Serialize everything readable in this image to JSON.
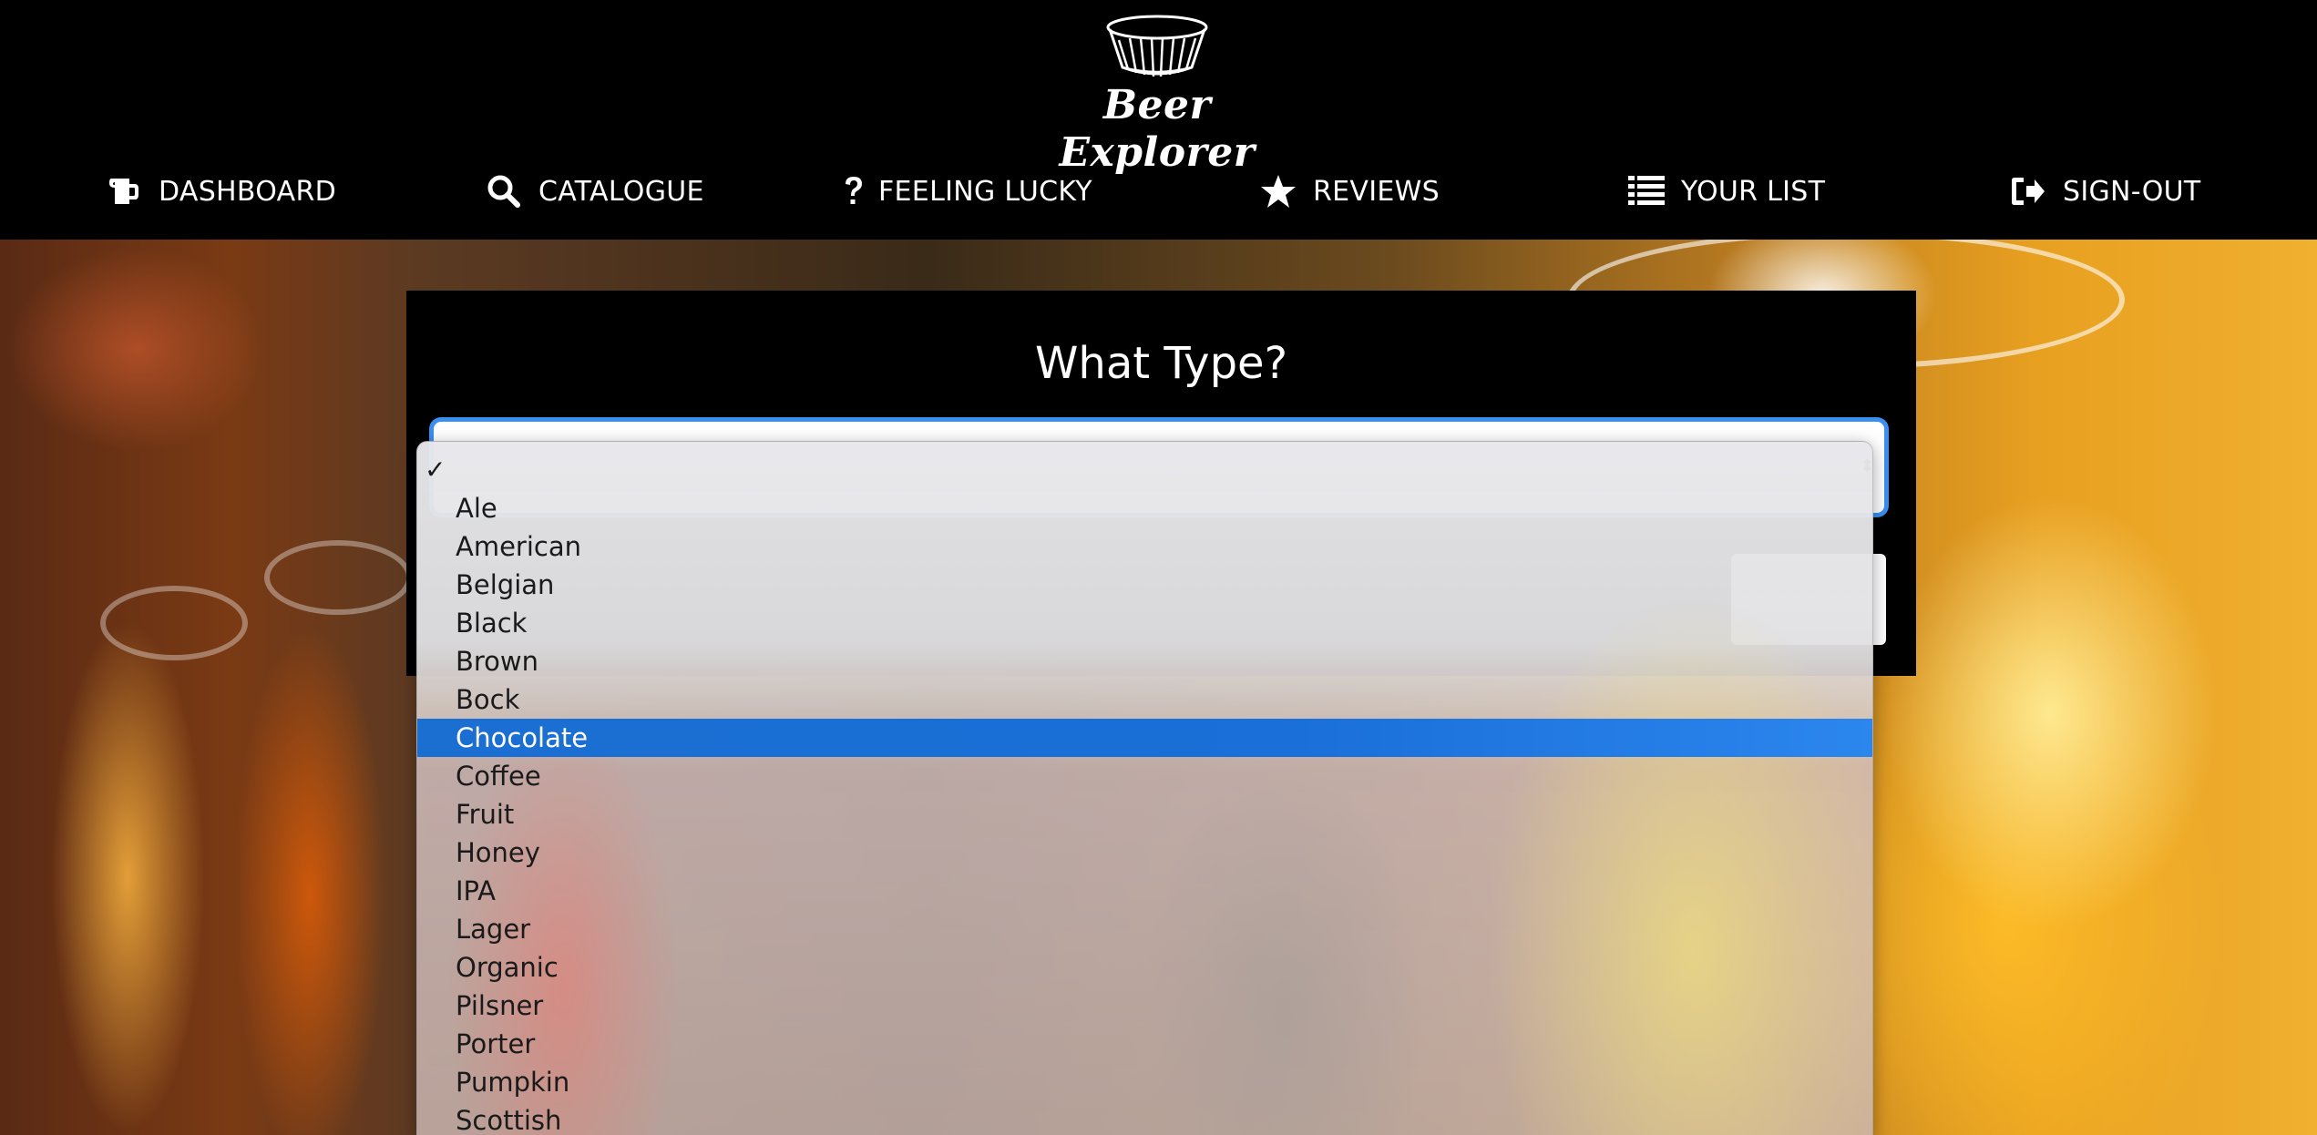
{
  "app": {
    "brand_name": "Beer Explorer"
  },
  "nav": {
    "items": [
      {
        "label": "DASHBOARD",
        "icon": "beer-mug-icon"
      },
      {
        "label": "CATALOGUE",
        "icon": "search-icon"
      },
      {
        "label": "FEELING LUCKY",
        "icon": "question-icon"
      },
      {
        "label": "REVIEWS",
        "icon": "star-icon"
      },
      {
        "label": "YOUR LIST",
        "icon": "list-icon"
      },
      {
        "label": "SIGN-OUT",
        "icon": "sign-out-icon"
      }
    ]
  },
  "panel": {
    "title": "What Type?",
    "select_value": ""
  },
  "dropdown": {
    "checked_symbol": "✓",
    "selected_option": "Chocolate",
    "options": [
      "",
      "Ale",
      "American",
      "Belgian",
      "Black",
      "Brown",
      "Bock",
      "Chocolate",
      "Coffee",
      "Fruit",
      "Honey",
      "IPA",
      "Lager",
      "Organic",
      "Pilsner",
      "Porter",
      "Pumpkin",
      "Scottish"
    ]
  },
  "colors": {
    "header_bg": "#000000",
    "focus_ring": "#3b8ff0",
    "selected_highlight": "#1a6fd8"
  }
}
